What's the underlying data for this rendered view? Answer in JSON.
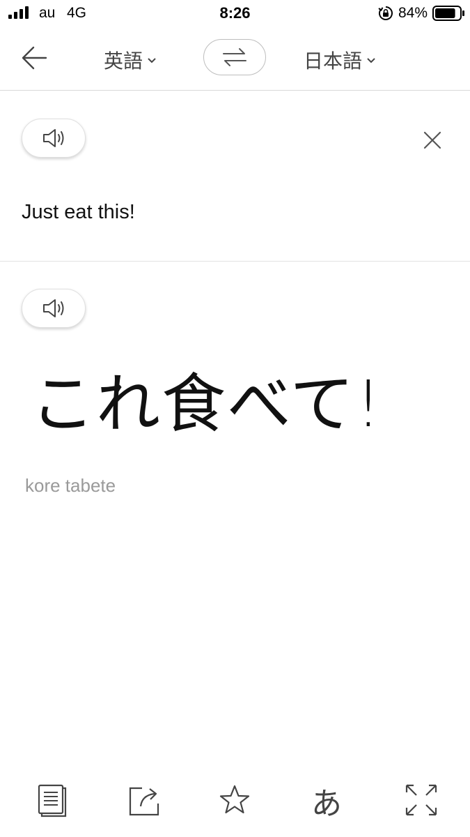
{
  "status_bar": {
    "carrier": "au",
    "network": "4G",
    "time": "8:26",
    "battery_percent": "84%",
    "battery_level": 0.84,
    "icons": [
      "signal-icon",
      "rotation-lock-icon",
      "battery-icon"
    ]
  },
  "nav": {
    "source_language": "英語",
    "target_language": "日本語",
    "icons": [
      "back-arrow-icon",
      "swap-languages-icon",
      "chevron-down-icon"
    ]
  },
  "source": {
    "text": "Just eat this!",
    "icons": [
      "speaker-icon",
      "close-icon"
    ]
  },
  "target": {
    "text": "これ食べて!",
    "romanization": "kore tabete",
    "icons": [
      "speaker-icon"
    ]
  },
  "toolbar": {
    "hiragana_glyph": "あ",
    "icons": [
      "copy-icon",
      "share-icon",
      "star-icon",
      "hiragana-icon",
      "fullscreen-icon"
    ]
  },
  "colors": {
    "text": "#111111",
    "secondary_text": "#9a9a9a",
    "icon": "#444444",
    "divider": "#d9d9d9"
  }
}
